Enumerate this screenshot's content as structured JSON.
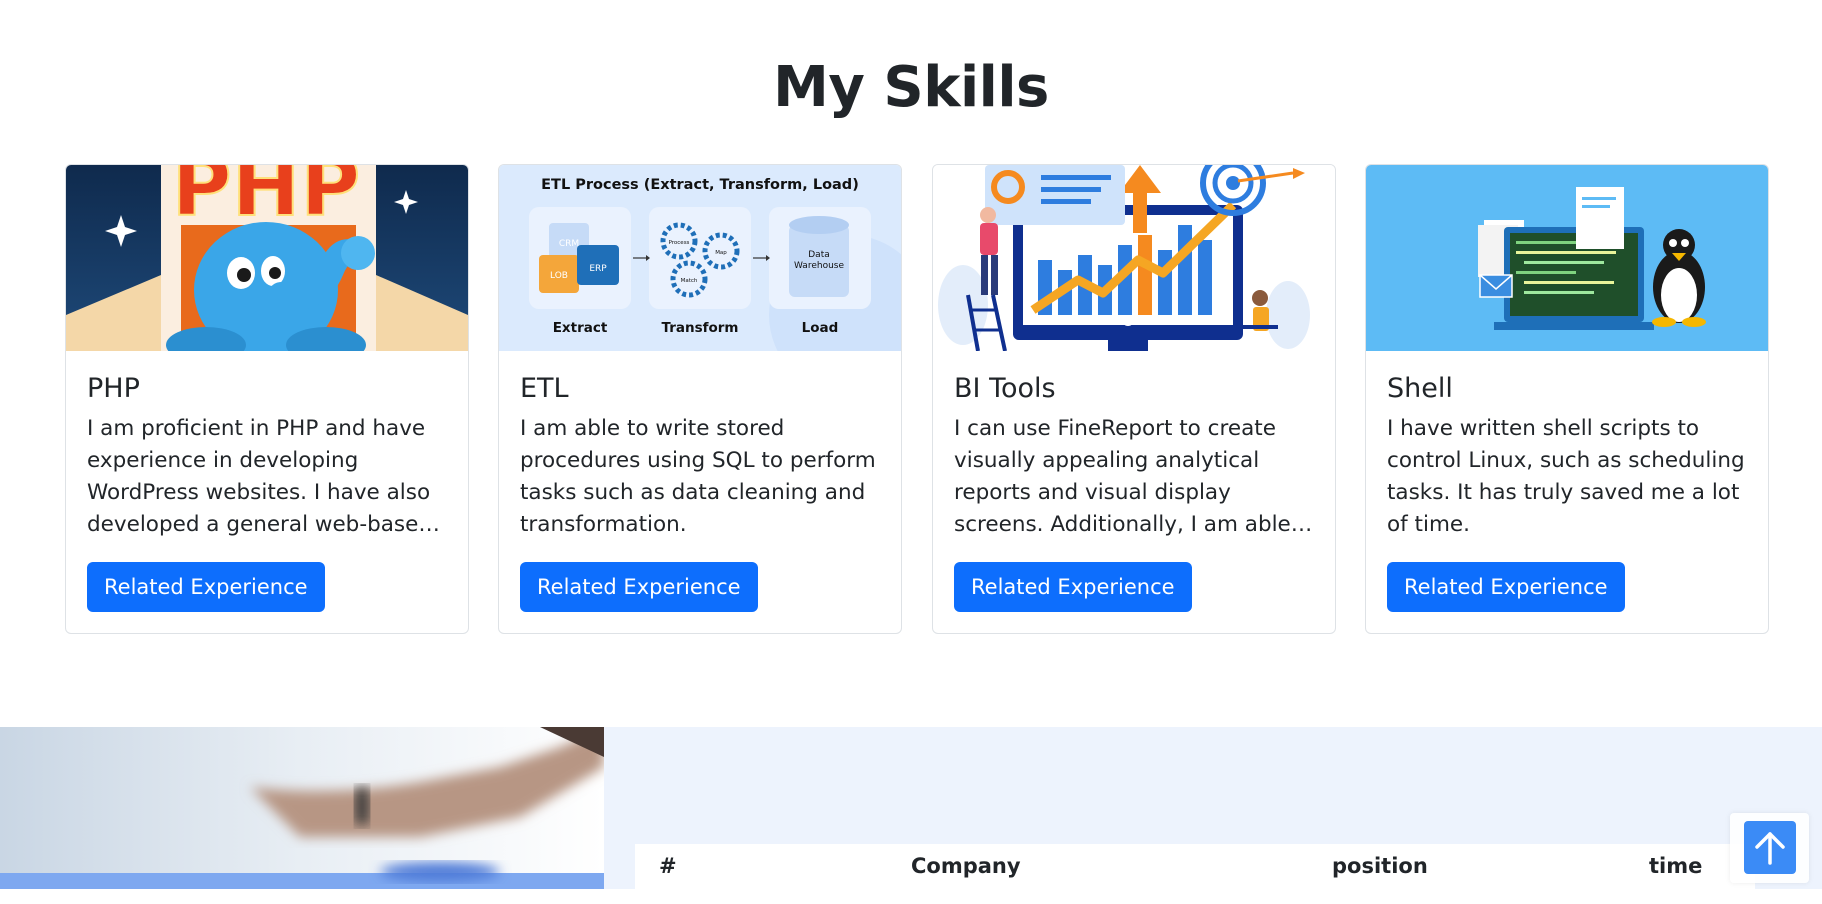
{
  "skills": {
    "title": "My Skills",
    "cards": [
      {
        "title": "PHP",
        "image_text": "PHP",
        "text": "I am proficient in PHP and have experience in developing WordPress websites. I have also developed a general web-based management system.",
        "button": "Related Experience"
      },
      {
        "title": "ETL",
        "image_text": {
          "heading": "ETL Process (Extract, Transform, Load)",
          "crm": "CRM",
          "lob": "LOB",
          "erp": "ERP",
          "process": "Process",
          "map": "Map",
          "match": "Match",
          "dw_line1": "Data",
          "dw_line2": "Warehouse",
          "extract": "Extract",
          "transform": "Transform",
          "load": "Load"
        },
        "text": "I am able to write stored procedures using SQL to perform tasks such as data cleaning and transformation.",
        "button": "Related Experience"
      },
      {
        "title": "BI Tools",
        "text": "I can use FineReport to create visually appealing analytical reports and visual display screens. Additionally, I am able to create dashboards with other BI tools.",
        "button": "Related Experience"
      },
      {
        "title": "Shell",
        "text": "I have written shell scripts to control Linux, such as scheduling tasks. It has truly saved me a lot of time.",
        "button": "Related Experience"
      }
    ]
  },
  "experience_table": {
    "headers": [
      "#",
      "Company",
      "position",
      "time"
    ]
  },
  "colors": {
    "primary": "#0d6efd",
    "panel": "#edf3fd",
    "scroll_button": "#3b8bf6"
  },
  "icons": {
    "scroll_top": "arrow-up-icon"
  }
}
